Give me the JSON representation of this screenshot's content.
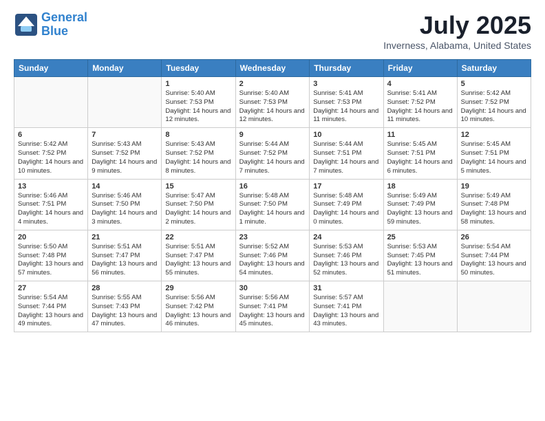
{
  "header": {
    "logo_line1": "General",
    "logo_line2": "Blue",
    "month_title": "July 2025",
    "location": "Inverness, Alabama, United States"
  },
  "weekdays": [
    "Sunday",
    "Monday",
    "Tuesday",
    "Wednesday",
    "Thursday",
    "Friday",
    "Saturday"
  ],
  "weeks": [
    [
      {
        "day": "",
        "empty": true
      },
      {
        "day": "",
        "empty": true
      },
      {
        "day": "1",
        "sunrise": "Sunrise: 5:40 AM",
        "sunset": "Sunset: 7:53 PM",
        "daylight": "Daylight: 14 hours and 12 minutes."
      },
      {
        "day": "2",
        "sunrise": "Sunrise: 5:40 AM",
        "sunset": "Sunset: 7:53 PM",
        "daylight": "Daylight: 14 hours and 12 minutes."
      },
      {
        "day": "3",
        "sunrise": "Sunrise: 5:41 AM",
        "sunset": "Sunset: 7:53 PM",
        "daylight": "Daylight: 14 hours and 11 minutes."
      },
      {
        "day": "4",
        "sunrise": "Sunrise: 5:41 AM",
        "sunset": "Sunset: 7:52 PM",
        "daylight": "Daylight: 14 hours and 11 minutes."
      },
      {
        "day": "5",
        "sunrise": "Sunrise: 5:42 AM",
        "sunset": "Sunset: 7:52 PM",
        "daylight": "Daylight: 14 hours and 10 minutes."
      }
    ],
    [
      {
        "day": "6",
        "sunrise": "Sunrise: 5:42 AM",
        "sunset": "Sunset: 7:52 PM",
        "daylight": "Daylight: 14 hours and 10 minutes."
      },
      {
        "day": "7",
        "sunrise": "Sunrise: 5:43 AM",
        "sunset": "Sunset: 7:52 PM",
        "daylight": "Daylight: 14 hours and 9 minutes."
      },
      {
        "day": "8",
        "sunrise": "Sunrise: 5:43 AM",
        "sunset": "Sunset: 7:52 PM",
        "daylight": "Daylight: 14 hours and 8 minutes."
      },
      {
        "day": "9",
        "sunrise": "Sunrise: 5:44 AM",
        "sunset": "Sunset: 7:52 PM",
        "daylight": "Daylight: 14 hours and 7 minutes."
      },
      {
        "day": "10",
        "sunrise": "Sunrise: 5:44 AM",
        "sunset": "Sunset: 7:51 PM",
        "daylight": "Daylight: 14 hours and 7 minutes."
      },
      {
        "day": "11",
        "sunrise": "Sunrise: 5:45 AM",
        "sunset": "Sunset: 7:51 PM",
        "daylight": "Daylight: 14 hours and 6 minutes."
      },
      {
        "day": "12",
        "sunrise": "Sunrise: 5:45 AM",
        "sunset": "Sunset: 7:51 PM",
        "daylight": "Daylight: 14 hours and 5 minutes."
      }
    ],
    [
      {
        "day": "13",
        "sunrise": "Sunrise: 5:46 AM",
        "sunset": "Sunset: 7:51 PM",
        "daylight": "Daylight: 14 hours and 4 minutes."
      },
      {
        "day": "14",
        "sunrise": "Sunrise: 5:46 AM",
        "sunset": "Sunset: 7:50 PM",
        "daylight": "Daylight: 14 hours and 3 minutes."
      },
      {
        "day": "15",
        "sunrise": "Sunrise: 5:47 AM",
        "sunset": "Sunset: 7:50 PM",
        "daylight": "Daylight: 14 hours and 2 minutes."
      },
      {
        "day": "16",
        "sunrise": "Sunrise: 5:48 AM",
        "sunset": "Sunset: 7:50 PM",
        "daylight": "Daylight: 14 hours and 1 minute."
      },
      {
        "day": "17",
        "sunrise": "Sunrise: 5:48 AM",
        "sunset": "Sunset: 7:49 PM",
        "daylight": "Daylight: 14 hours and 0 minutes."
      },
      {
        "day": "18",
        "sunrise": "Sunrise: 5:49 AM",
        "sunset": "Sunset: 7:49 PM",
        "daylight": "Daylight: 13 hours and 59 minutes."
      },
      {
        "day": "19",
        "sunrise": "Sunrise: 5:49 AM",
        "sunset": "Sunset: 7:48 PM",
        "daylight": "Daylight: 13 hours and 58 minutes."
      }
    ],
    [
      {
        "day": "20",
        "sunrise": "Sunrise: 5:50 AM",
        "sunset": "Sunset: 7:48 PM",
        "daylight": "Daylight: 13 hours and 57 minutes."
      },
      {
        "day": "21",
        "sunrise": "Sunrise: 5:51 AM",
        "sunset": "Sunset: 7:47 PM",
        "daylight": "Daylight: 13 hours and 56 minutes."
      },
      {
        "day": "22",
        "sunrise": "Sunrise: 5:51 AM",
        "sunset": "Sunset: 7:47 PM",
        "daylight": "Daylight: 13 hours and 55 minutes."
      },
      {
        "day": "23",
        "sunrise": "Sunrise: 5:52 AM",
        "sunset": "Sunset: 7:46 PM",
        "daylight": "Daylight: 13 hours and 54 minutes."
      },
      {
        "day": "24",
        "sunrise": "Sunrise: 5:53 AM",
        "sunset": "Sunset: 7:46 PM",
        "daylight": "Daylight: 13 hours and 52 minutes."
      },
      {
        "day": "25",
        "sunrise": "Sunrise: 5:53 AM",
        "sunset": "Sunset: 7:45 PM",
        "daylight": "Daylight: 13 hours and 51 minutes."
      },
      {
        "day": "26",
        "sunrise": "Sunrise: 5:54 AM",
        "sunset": "Sunset: 7:44 PM",
        "daylight": "Daylight: 13 hours and 50 minutes."
      }
    ],
    [
      {
        "day": "27",
        "sunrise": "Sunrise: 5:54 AM",
        "sunset": "Sunset: 7:44 PM",
        "daylight": "Daylight: 13 hours and 49 minutes."
      },
      {
        "day": "28",
        "sunrise": "Sunrise: 5:55 AM",
        "sunset": "Sunset: 7:43 PM",
        "daylight": "Daylight: 13 hours and 47 minutes."
      },
      {
        "day": "29",
        "sunrise": "Sunrise: 5:56 AM",
        "sunset": "Sunset: 7:42 PM",
        "daylight": "Daylight: 13 hours and 46 minutes."
      },
      {
        "day": "30",
        "sunrise": "Sunrise: 5:56 AM",
        "sunset": "Sunset: 7:41 PM",
        "daylight": "Daylight: 13 hours and 45 minutes."
      },
      {
        "day": "31",
        "sunrise": "Sunrise: 5:57 AM",
        "sunset": "Sunset: 7:41 PM",
        "daylight": "Daylight: 13 hours and 43 minutes."
      },
      {
        "day": "",
        "empty": true
      },
      {
        "day": "",
        "empty": true
      }
    ]
  ]
}
